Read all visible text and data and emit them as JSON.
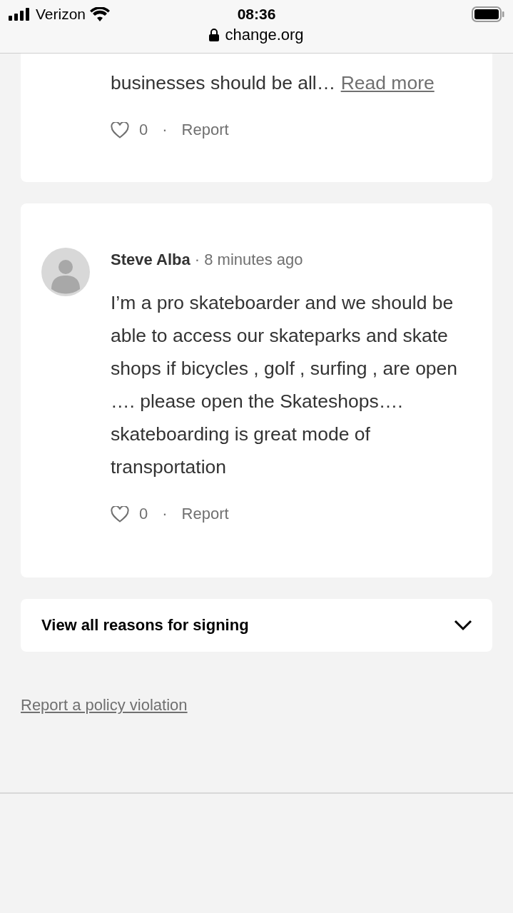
{
  "status_bar": {
    "carrier": "Verizon",
    "time": "08:36"
  },
  "address_bar": {
    "url": "change.org"
  },
  "comments": [
    {
      "kind": "truncated",
      "text": "businesses should be all…",
      "read_more": "Read more",
      "likes": "0",
      "separator": "·",
      "report": "Report"
    },
    {
      "kind": "full",
      "author": "Steve Alba",
      "author_separator": "·",
      "time_ago": "8 minutes ago",
      "text": "I’m a pro skateboarder and we should be able to access our skateparks and skate shops if bicycles , golf , surfing , are open …. please open the Skateshops…. skateboarding is great mode of transportation",
      "likes": "0",
      "separator": "·",
      "report": "Report"
    }
  ],
  "expand_bar": {
    "label": "View all reasons for signing",
    "expanded": false
  },
  "policy_link": "Report a policy violation"
}
